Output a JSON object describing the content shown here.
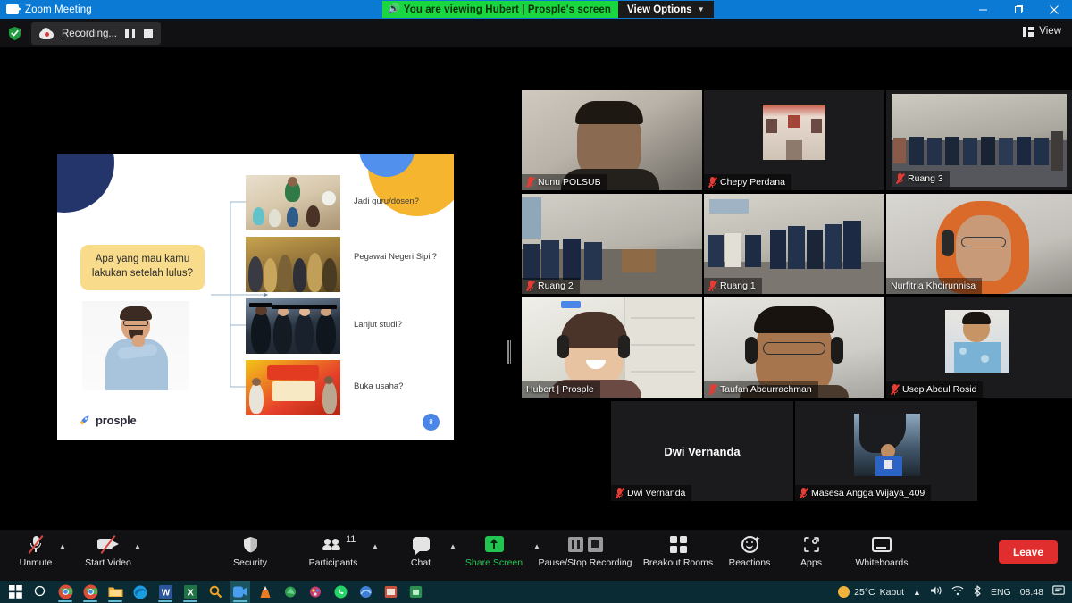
{
  "window": {
    "title": "Zoom Meeting",
    "app_icon": "zoom-camera-icon",
    "minimize": "minimize-icon",
    "maximize": "maximize-icon",
    "close": "close-icon"
  },
  "share_banner": {
    "speaker_icon": "speaker-icon",
    "text": "You are viewing Hubert | Prosple's screen",
    "view_options_label": "View Options",
    "caret": "⌄",
    "bg_color": "#1ad741"
  },
  "topbar": {
    "encryption_icon": "green-shield-icon",
    "recording_label": "Recording...",
    "record_icon": "cloud-record-icon",
    "pause_icon": "pause-icon",
    "stop_icon": "stop-icon",
    "view_label": "View",
    "view_icon": "layout-icon"
  },
  "slide": {
    "question": "Apa yang mau kamu lakukan setelah lulus?",
    "options": [
      {
        "label": "Jadi guru/dosen?",
        "photo": "teacher-classroom-photo"
      },
      {
        "label": "Pegawai Negeri Sipil?",
        "photo": "civil-servants-photo"
      },
      {
        "label": "Lanjut studi?",
        "photo": "graduates-photo"
      },
      {
        "label": "Buka usaha?",
        "photo": "street-food-stall-photo"
      }
    ],
    "logo_text": "prosple",
    "logo_icon": "rocket-icon",
    "page_number": "8",
    "person_image": "thinking-man-photo",
    "colors": {
      "navy": "#23356b",
      "yellow": "#f5b52e",
      "blue": "#5290ee",
      "callout": "#f8dc8c"
    }
  },
  "gallery": {
    "tiles": [
      {
        "name": "Nunu POLSUB",
        "muted": true,
        "video": true,
        "active_speaker": false,
        "layout": "r1c1"
      },
      {
        "name": "Chepy Perdana",
        "muted": true,
        "video": true,
        "active_speaker": false,
        "layout": "r1c2"
      },
      {
        "name": "Ruang 3",
        "muted": true,
        "video": true,
        "active_speaker": false,
        "layout": "r1c3"
      },
      {
        "name": "Ruang 2",
        "muted": true,
        "video": true,
        "active_speaker": false,
        "layout": "r2c1"
      },
      {
        "name": "Ruang 1",
        "muted": true,
        "video": true,
        "active_speaker": false,
        "layout": "r2c2"
      },
      {
        "name": "Nurfitria Khoirunnisa",
        "muted": false,
        "video": true,
        "active_speaker": false,
        "layout": "r2c3"
      },
      {
        "name": "Hubert | Prosple",
        "muted": false,
        "video": true,
        "active_speaker": true,
        "layout": "r3c1"
      },
      {
        "name": "Taufan Abdurrachman",
        "muted": true,
        "video": true,
        "active_speaker": false,
        "layout": "r3c2"
      },
      {
        "name": "Usep Abdul Rosid",
        "muted": true,
        "video": true,
        "active_speaker": false,
        "layout": "r3c3"
      },
      {
        "name": "Dwi Vernanda",
        "muted": true,
        "video": false,
        "active_speaker": false,
        "layout": "r4c1",
        "placeholder_name": "Dwi Vernanda"
      },
      {
        "name": "Masesa Angga Wijaya_409",
        "muted": true,
        "video": true,
        "active_speaker": false,
        "layout": "r4c2"
      }
    ],
    "active_speaker_color": "#bde03a"
  },
  "controls": [
    {
      "id": "unmute",
      "label": "Unmute",
      "icon": "microphone-muted-icon",
      "caret": true,
      "accent": false
    },
    {
      "id": "start-video",
      "label": "Start Video",
      "icon": "camera-off-icon",
      "caret": true,
      "accent": false
    },
    {
      "id": "security",
      "label": "Security",
      "icon": "shield-icon",
      "caret": false,
      "accent": false
    },
    {
      "id": "participants",
      "label": "Participants",
      "icon": "people-icon",
      "caret": true,
      "accent": false,
      "badge": "11"
    },
    {
      "id": "chat",
      "label": "Chat",
      "icon": "chat-bubble-icon",
      "caret": true,
      "accent": false
    },
    {
      "id": "share-screen",
      "label": "Share Screen",
      "icon": "share-screen-icon",
      "caret": true,
      "accent": true
    },
    {
      "id": "recording",
      "label": "Pause/Stop Recording",
      "icon": "pause-stop-recording-icon",
      "caret": false,
      "accent": false
    },
    {
      "id": "breakout-rooms",
      "label": "Breakout Rooms",
      "icon": "breakout-rooms-icon",
      "caret": false,
      "accent": false
    },
    {
      "id": "reactions",
      "label": "Reactions",
      "icon": "reactions-icon",
      "caret": false,
      "accent": false
    },
    {
      "id": "apps",
      "label": "Apps",
      "icon": "apps-icon",
      "caret": false,
      "accent": false
    },
    {
      "id": "whiteboards",
      "label": "Whiteboards",
      "icon": "whiteboard-icon",
      "caret": false,
      "accent": false
    }
  ],
  "leave": {
    "label": "Leave",
    "color": "#e02d2d"
  },
  "taskbar": {
    "icons": [
      "start-icon",
      "search-icon",
      "chrome-icon",
      "chrome-icon",
      "file-explorer-icon",
      "edge-icon",
      "word-icon",
      "excel-icon",
      "everything-search-icon",
      "zoom-icon",
      "vlc-icon",
      "greenshot-icon",
      "paint-icon",
      "whatsapp-icon",
      "blue-app-icon",
      "archive-icon",
      "green-app-icon"
    ],
    "tray": {
      "weather_temp": "25°C",
      "weather_desc": "Kabut",
      "weather_icon": "sun-cloud-icon",
      "chevron_icon": "show-hidden-icons-chevron",
      "volume_icon": "volume-icon",
      "wifi_icon": "wifi-icon",
      "bluetooth_icon": "bluetooth-icon",
      "language": "ENG",
      "time": "08.48",
      "notification_icon": "notification-icon"
    }
  }
}
